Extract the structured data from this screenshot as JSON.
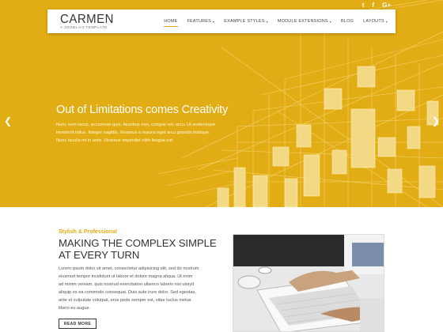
{
  "social": [
    {
      "name": "twitter-icon",
      "glyph": "t"
    },
    {
      "name": "facebook-icon",
      "glyph": "f"
    },
    {
      "name": "google-plus-icon",
      "glyph": "G+"
    }
  ],
  "logo": {
    "title": "CARMEN",
    "subtitle": "A JOOMLA!3 TEMPLATE"
  },
  "nav": [
    {
      "label": "HOME",
      "active": true,
      "dropdown": false
    },
    {
      "label": "FEATURES",
      "active": false,
      "dropdown": true
    },
    {
      "label": "EXAMPLE STYLES",
      "active": false,
      "dropdown": true
    },
    {
      "label": "MODULE EXTENSIONS",
      "active": false,
      "dropdown": true
    },
    {
      "label": "BLOG",
      "active": false,
      "dropdown": false
    },
    {
      "label": "LAYOUTS",
      "active": false,
      "dropdown": true
    }
  ],
  "hero": {
    "title": "Out of Limitations comes Creativity",
    "lines": [
      "Nunc sem lacus, accumsan quis, faucibus non, congue vel, arcu. Ut scelerisque",
      "hendrerit tellus. Integer sagittis. Vivamus a mauris eget arcu gravida tristique.",
      "Nunc iaculis mi in ante. Vivamus imperdiet nibh feugiat est."
    ]
  },
  "content": {
    "eyebrow": "Stylish & Professional",
    "title": "MAKING THE COMPLEX SIMPLE AT EVERY TURN",
    "paragraph": [
      "Lorem ipsum dolor sit amet, consectetur adipisicing elit, sed do nostrum",
      "eiusmod tempor incididunt ut labore et dolore magna aliqua. Ut enim",
      "ad minim veniam, quis nostrud exercitation ullamco laboris nisi utoiyit",
      "aliquip ex ea commodo consequat. Duis aute irure dolor. Sed egestas,",
      "ante et vulputate volutpat, eros pede semper est, vitae luctus metus",
      "libero eu augue."
    ],
    "button": "READ MORE"
  },
  "colors": {
    "accent": "#e2ad14",
    "hero_bg": "#e2ad14"
  }
}
